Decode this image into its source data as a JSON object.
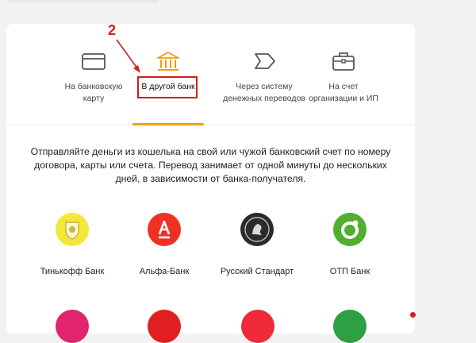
{
  "annotation": {
    "step_number": "2"
  },
  "tabs": [
    {
      "label": "На банковскую\nкарту",
      "icon": "card-icon"
    },
    {
      "label": "В другой банк",
      "icon": "bank-icon",
      "active": true
    },
    {
      "label": "Через систему\nденежных переводов",
      "icon": "transfer-arrow-icon"
    },
    {
      "label": "На счет\nорганизации и ИП",
      "icon": "briefcase-icon"
    }
  ],
  "description": "Отправляйте деньги из кошелька на свой или чужой банковский счет по номеру договора, карты или счета. Перевод занимает от одной минуты до нескольких дней, в зависимости от банка-получателя.",
  "banks": [
    {
      "name": "Тинькофф Банк",
      "icon": "tinkoff-logo-icon",
      "color": "#f5e63a"
    },
    {
      "name": "Альфа-Банк",
      "icon": "alfa-logo-icon",
      "color": "#ef3124"
    },
    {
      "name": "Русский Стандарт",
      "icon": "russian-standard-logo-icon",
      "color": "#2b2b2b"
    },
    {
      "name": "ОТП Банк",
      "icon": "otp-logo-icon",
      "color": "#52ae30"
    }
  ],
  "colors": {
    "accent": "#f39c12",
    "annotation_red": "#d81b1b"
  }
}
